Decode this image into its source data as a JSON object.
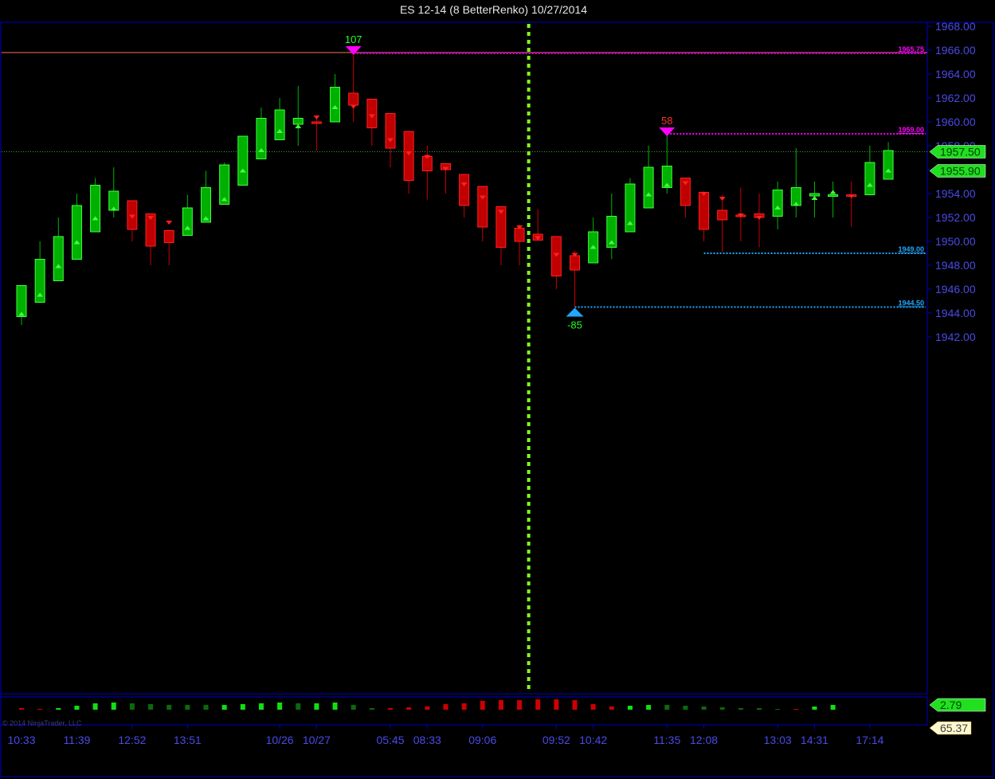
{
  "title": "ES 12-14 (8 BetterRenko)  10/27/2014",
  "copyright": "© 2014 NinjaTrader, LLC",
  "colors": {
    "background": "#000000",
    "frame": "#0000c8",
    "axis_text": "#4a4ae6",
    "up_candle": "#00b400",
    "down_candle": "#c80000",
    "session_break": "#80ff20",
    "swing_high": "#ff00ff",
    "swing_low": "#20a8ff"
  },
  "chart_data": {
    "type": "candlestick",
    "instrument": "ES 12-14",
    "bar_type": "8 BetterRenko",
    "ylim": [
      1940.0,
      1968.0
    ],
    "y_ticks": [
      "1968.00",
      "1966.00",
      "1964.00",
      "1962.00",
      "1960.00",
      "1958.00",
      "1956.00",
      "1954.00",
      "1952.00",
      "1950.00",
      "1948.00",
      "1946.00",
      "1944.00",
      "1942.00"
    ],
    "x_labels": [
      {
        "bar": 0,
        "label": "10:33"
      },
      {
        "bar": 3,
        "label": "11:39"
      },
      {
        "bar": 6,
        "label": "12:52"
      },
      {
        "bar": 9,
        "label": "13:51"
      },
      {
        "bar": 14,
        "label": "10/26"
      },
      {
        "bar": 16,
        "label": "10/27"
      },
      {
        "bar": 20,
        "label": "05:45"
      },
      {
        "bar": 22,
        "label": "08:33"
      },
      {
        "bar": 25,
        "label": "09:06"
      },
      {
        "bar": 29,
        "label": "09:52"
      },
      {
        "bar": 31,
        "label": "10:42"
      },
      {
        "bar": 35,
        "label": "11:35"
      },
      {
        "bar": 37,
        "label": "12:08"
      },
      {
        "bar": 41,
        "label": "13:03"
      },
      {
        "bar": 43,
        "label": "14:31"
      },
      {
        "bar": 46,
        "label": "17:14"
      }
    ],
    "candles": [
      {
        "o": 1943.7,
        "h": 1946.2,
        "l": 1943.0,
        "c": 1946.3,
        "m": 1943.9
      },
      {
        "o": 1944.9,
        "h": 1950.0,
        "l": 1944.9,
        "c": 1948.5,
        "m": 1945.5
      },
      {
        "o": 1946.7,
        "h": 1952.0,
        "l": 1946.7,
        "c": 1950.4,
        "m": 1947.9
      },
      {
        "o": 1948.5,
        "h": 1954.0,
        "l": 1948.5,
        "c": 1953.0,
        "m": 1949.9
      },
      {
        "o": 1950.8,
        "h": 1955.3,
        "l": 1950.8,
        "c": 1954.7,
        "m": 1951.9
      },
      {
        "o": 1952.6,
        "h": 1956.2,
        "l": 1952.0,
        "c": 1954.2,
        "m": 1952.7
      },
      {
        "o": 1953.4,
        "h": 1953.4,
        "l": 1950.0,
        "c": 1951.0,
        "m": 1952.1
      },
      {
        "o": 1952.3,
        "h": 1952.3,
        "l": 1948.0,
        "c": 1949.6,
        "m": 1952.0
      },
      {
        "o": 1950.9,
        "h": 1951.0,
        "l": 1948.0,
        "c": 1949.9,
        "m": 1951.6
      },
      {
        "o": 1950.5,
        "h": 1953.9,
        "l": 1950.5,
        "c": 1952.8,
        "m": 1951.1
      },
      {
        "o": 1951.6,
        "h": 1955.9,
        "l": 1951.6,
        "c": 1954.5,
        "m": 1951.9
      },
      {
        "o": 1953.1,
        "h": 1956.6,
        "l": 1953.1,
        "c": 1956.4,
        "m": 1953.5
      },
      {
        "o": 1954.7,
        "h": 1958.0,
        "l": 1954.7,
        "c": 1958.8,
        "m": 1955.9
      },
      {
        "o": 1956.9,
        "h": 1961.2,
        "l": 1956.9,
        "c": 1960.3,
        "m": 1957.6
      },
      {
        "o": 1958.5,
        "h": 1962.0,
        "l": 1958.5,
        "c": 1961.0,
        "m": 1959.2
      },
      {
        "o": 1959.8,
        "h": 1963.0,
        "l": 1958.0,
        "c": 1960.3,
        "m": 1959.6
      },
      {
        "o": 1960.0,
        "h": 1960.3,
        "l": 1957.6,
        "c": 1959.9,
        "m": 1960.4
      },
      {
        "o": 1960.0,
        "h": 1964.0,
        "l": 1960.0,
        "c": 1962.9,
        "m": 1961.2
      },
      {
        "o": 1962.4,
        "h": 1965.8,
        "l": 1960.0,
        "c": 1961.4,
        "m": 1961.3
      },
      {
        "o": 1961.9,
        "h": 1961.9,
        "l": 1958.0,
        "c": 1959.5,
        "m": 1960.5
      },
      {
        "o": 1960.7,
        "h": 1960.7,
        "l": 1956.2,
        "c": 1957.8,
        "m": 1958.5
      },
      {
        "o": 1959.2,
        "h": 1959.2,
        "l": 1954.0,
        "c": 1955.1,
        "m": 1957.4
      },
      {
        "o": 1957.1,
        "h": 1958.0,
        "l": 1953.5,
        "c": 1955.9,
        "m": 1957.1
      },
      {
        "o": 1956.5,
        "h": 1956.5,
        "l": 1954.0,
        "c": 1956.0,
        "m": 1956.1
      },
      {
        "o": 1955.6,
        "h": 1955.6,
        "l": 1952.0,
        "c": 1953.0,
        "m": 1954.8
      },
      {
        "o": 1954.6,
        "h": 1954.6,
        "l": 1950.0,
        "c": 1951.2,
        "m": 1953.7
      },
      {
        "o": 1952.9,
        "h": 1952.9,
        "l": 1948.0,
        "c": 1949.5,
        "m": 1952.5
      },
      {
        "o": 1951.1,
        "h": 1951.4,
        "l": 1948.0,
        "c": 1950.0,
        "m": 1951.2
      },
      {
        "o": 1950.6,
        "h": 1952.7,
        "l": 1950.1,
        "c": 1950.1,
        "m": 1950.3
      },
      {
        "o": 1950.4,
        "h": 1950.4,
        "l": 1946.0,
        "c": 1947.1,
        "m": 1948.9
      },
      {
        "o": 1948.8,
        "h": 1949.2,
        "l": 1944.5,
        "c": 1947.6,
        "m": 1948.9
      },
      {
        "o": 1948.2,
        "h": 1952.0,
        "l": 1948.2,
        "c": 1950.8,
        "m": 1949.5
      },
      {
        "o": 1949.5,
        "h": 1954.0,
        "l": 1948.5,
        "c": 1952.1,
        "m": 1949.9
      },
      {
        "o": 1950.8,
        "h": 1955.3,
        "l": 1950.8,
        "c": 1954.8,
        "m": 1951.5
      },
      {
        "o": 1952.8,
        "h": 1958.0,
        "l": 1952.8,
        "c": 1956.2,
        "m": 1953.9
      },
      {
        "o": 1954.5,
        "h": 1959.0,
        "l": 1954.0,
        "c": 1956.3,
        "m": 1954.7
      },
      {
        "o": 1955.3,
        "h": 1955.3,
        "l": 1952.0,
        "c": 1953.0,
        "m": 1954.9
      },
      {
        "o": 1954.1,
        "h": 1954.2,
        "l": 1950.0,
        "c": 1951.0,
        "m": 1954.0
      },
      {
        "o": 1952.6,
        "h": 1953.9,
        "l": 1949.1,
        "c": 1951.8,
        "m": 1953.6
      },
      {
        "o": 1952.2,
        "h": 1954.5,
        "l": 1950.0,
        "c": 1952.1,
        "m": 1952.2
      },
      {
        "o": 1952.3,
        "h": 1954.0,
        "l": 1949.5,
        "c": 1952.0,
        "m": 1952.0
      },
      {
        "o": 1952.1,
        "h": 1955.0,
        "l": 1951.0,
        "c": 1954.3,
        "m": 1952.8
      },
      {
        "o": 1953.0,
        "h": 1957.8,
        "l": 1952.0,
        "c": 1954.5,
        "m": 1953.1
      },
      {
        "o": 1953.8,
        "h": 1955.0,
        "l": 1952.0,
        "c": 1954.0,
        "m": 1953.6
      },
      {
        "o": 1953.9,
        "h": 1955.0,
        "l": 1952.0,
        "c": 1953.9,
        "m": 1954.1
      },
      {
        "o": 1953.9,
        "h": 1955.0,
        "l": 1951.2,
        "c": 1953.8,
        "m": 1953.8
      },
      {
        "o": 1953.9,
        "h": 1958.0,
        "l": 1953.9,
        "c": 1956.6,
        "m": 1954.7
      },
      {
        "o": 1955.2,
        "h": 1958.3,
        "l": 1955.2,
        "c": 1957.6,
        "m": 1955.9
      }
    ],
    "session_break_bar": 27.5,
    "horizontal_lines": [
      {
        "price": 1965.75,
        "label": "1965.75",
        "color": "#ff00ff",
        "from_bar": 18
      },
      {
        "price": 1959.0,
        "label": "1959.00",
        "color": "#ff00ff",
        "from_bar": 35
      },
      {
        "price": 1949.0,
        "label": "1949.00",
        "color": "#20a8ff",
        "from_bar": 37
      },
      {
        "price": 1944.5,
        "label": "1944.50",
        "color": "#20a8ff",
        "from_bar": 30
      }
    ],
    "full_width_lines": [
      {
        "price": 1965.8,
        "color": "#ff7060"
      },
      {
        "price": 1957.5,
        "color": "#40a040"
      }
    ],
    "swing_markers": [
      {
        "bar": 18,
        "price": 1965.8,
        "type": "high",
        "label": "107",
        "label_color": "#20ff20"
      },
      {
        "bar": 35,
        "price": 1959.0,
        "type": "high",
        "label": "58",
        "label_color": "#ff3030"
      },
      {
        "bar": 30,
        "price": 1944.5,
        "type": "low",
        "label": "-85",
        "label_color": "#20ff20"
      }
    ],
    "price_flags": [
      {
        "price": 1957.5,
        "label": "1957.50",
        "color": "#20e020"
      },
      {
        "price": 1955.9,
        "label": "1955.90",
        "color": "#20e020"
      }
    ],
    "indicator": {
      "current_value": "2.79",
      "secondary_value": "65.37",
      "bars": [
        {
          "s": "r",
          "h": 2
        },
        {
          "s": "r",
          "h": 1
        },
        {
          "s": "g",
          "h": 2
        },
        {
          "s": "g",
          "h": 5
        },
        {
          "s": "g",
          "h": 8
        },
        {
          "s": "g",
          "h": 9
        },
        {
          "s": "d",
          "h": 8
        },
        {
          "s": "d",
          "h": 7
        },
        {
          "s": "d",
          "h": 6
        },
        {
          "s": "d",
          "h": 6
        },
        {
          "s": "d",
          "h": 6
        },
        {
          "s": "g",
          "h": 6
        },
        {
          "s": "g",
          "h": 7
        },
        {
          "s": "g",
          "h": 8
        },
        {
          "s": "g",
          "h": 9
        },
        {
          "s": "d",
          "h": 8
        },
        {
          "s": "g",
          "h": 8
        },
        {
          "s": "g",
          "h": 9
        },
        {
          "s": "d",
          "h": 6
        },
        {
          "s": "d",
          "h": 2
        },
        {
          "s": "r",
          "h": 2
        },
        {
          "s": "r",
          "h": 3
        },
        {
          "s": "r",
          "h": 4
        },
        {
          "s": "r",
          "h": 7
        },
        {
          "s": "r",
          "h": 8
        },
        {
          "s": "r",
          "h": 11
        },
        {
          "s": "r",
          "h": 12
        },
        {
          "s": "r",
          "h": 12
        },
        {
          "s": "r",
          "h": 13
        },
        {
          "s": "r",
          "h": 13
        },
        {
          "s": "r",
          "h": 12
        },
        {
          "s": "r",
          "h": 7
        },
        {
          "s": "r",
          "h": 4
        },
        {
          "s": "g",
          "h": 5
        },
        {
          "s": "g",
          "h": 6
        },
        {
          "s": "d",
          "h": 6
        },
        {
          "s": "d",
          "h": 5
        },
        {
          "s": "d",
          "h": 4
        },
        {
          "s": "d",
          "h": 3
        },
        {
          "s": "d",
          "h": 2
        },
        {
          "s": "d",
          "h": 2
        },
        {
          "s": "d",
          "h": 1
        },
        {
          "s": "r",
          "h": 1
        },
        {
          "s": "g",
          "h": 4
        },
        {
          "s": "g",
          "h": 6
        }
      ]
    }
  }
}
